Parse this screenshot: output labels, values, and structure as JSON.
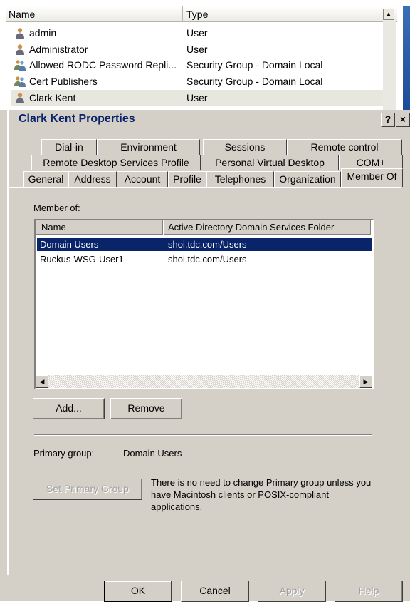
{
  "background_list": {
    "columns": [
      "Name",
      "Type"
    ],
    "rows": [
      {
        "name": "admin",
        "type": "User",
        "icon": "user-icon"
      },
      {
        "name": "Administrator",
        "type": "User",
        "icon": "user-icon"
      },
      {
        "name": "Allowed RODC Password Repli...",
        "type": "Security Group - Domain Local",
        "icon": "group-icon"
      },
      {
        "name": "Cert Publishers",
        "type": "Security Group - Domain Local",
        "icon": "group-icon"
      },
      {
        "name": "Clark Kent",
        "type": "User",
        "icon": "user-icon"
      }
    ]
  },
  "dialog": {
    "title": "Clark Kent Properties",
    "help_button": "?",
    "close_button": "×",
    "tabs_row1": [
      "Dial-in",
      "Environment",
      "Sessions",
      "Remote control"
    ],
    "tabs_row2": [
      "Remote Desktop Services Profile",
      "Personal Virtual Desktop",
      "COM+"
    ],
    "tabs_row3": [
      "General",
      "Address",
      "Account",
      "Profile",
      "Telephones",
      "Organization",
      "Member Of"
    ],
    "active_tab": "Member Of"
  },
  "member_of": {
    "label": "Member of:",
    "columns": [
      "Name",
      "Active Directory Domain Services Folder"
    ],
    "rows": [
      {
        "name": "Domain Users",
        "folder": "shoi.tdc.com/Users",
        "selected": true
      },
      {
        "name": "Ruckus-WSG-User1",
        "folder": "shoi.tdc.com/Users",
        "selected": false
      }
    ],
    "add_label": "Add...",
    "remove_label": "Remove"
  },
  "primary_group": {
    "label": "Primary group:",
    "value": "Domain Users",
    "set_button": "Set Primary Group",
    "note": "There is no need to change Primary group unless you have Macintosh clients or POSIX-compliant applications."
  },
  "footer": {
    "ok": "OK",
    "cancel": "Cancel",
    "apply": "Apply",
    "help": "Help"
  },
  "colors": {
    "dialog_bg": "#d4d0c8",
    "selection": "#0a246a",
    "title_text": "#0a246a"
  }
}
